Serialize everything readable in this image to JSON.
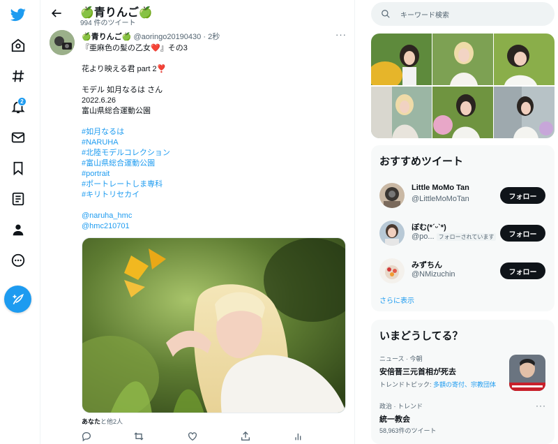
{
  "header": {
    "name": "🍏青りんご🍏",
    "tweet_count": "994 件のツイート"
  },
  "nav": {
    "notification_badge": "2"
  },
  "tweet": {
    "display_name": "🍏青りんご🍏",
    "handle": "@aoringo20190430",
    "sep": "·",
    "time": "2秒",
    "more": "···",
    "lines": [
      {
        "t": "『亜麻色の髪の乙女❤️』その3",
        "h": false
      },
      {
        "t": "",
        "h": false
      },
      {
        "t": "花より映える君 part 2❣️",
        "h": false
      },
      {
        "t": "",
        "h": false
      },
      {
        "t": "モデル 如月なるは さん",
        "h": false
      },
      {
        "t": "2022.6.26",
        "h": false
      },
      {
        "t": "富山県総合運動公園",
        "h": false
      },
      {
        "t": "",
        "h": false
      },
      {
        "t": "#如月なるは",
        "h": true
      },
      {
        "t": "#NARUHA",
        "h": true
      },
      {
        "t": "#北陸モデルコレクション",
        "h": true
      },
      {
        "t": "#富山県総合運動公園",
        "h": true
      },
      {
        "t": "#portrait",
        "h": true
      },
      {
        "t": "#ポートレートしま専科",
        "h": true
      },
      {
        "t": "#キリトリセカイ",
        "h": true
      },
      {
        "t": "",
        "h": false
      },
      {
        "t": "@naruha_hmc",
        "h": true
      },
      {
        "t": "@hmc210701",
        "h": true
      }
    ],
    "liked_by_user": "あなた",
    "liked_by_rest": "と他2人"
  },
  "search": {
    "placeholder": "キーワード検索"
  },
  "recommended": {
    "title": "おすすめツイート",
    "users": [
      {
        "name": "Little MoMo Tan",
        "handle": "@LittleMoMoTan",
        "button": "フォロー"
      },
      {
        "name": "ぼむ(*´ᵕ`*)",
        "handle": "@po...",
        "follows_you": "フォローされています",
        "button": "フォロー"
      },
      {
        "name": "みずちん",
        "handle": "@NMizuchin",
        "button": "フォロー"
      }
    ],
    "show_more": "さらに表示"
  },
  "trends": {
    "title": "いまどうしてる？",
    "items": [
      {
        "context": "ニュース · 今朝",
        "title": "安倍晋三元首相が死去",
        "topic_prefix": "トレンドトピック: ",
        "topic_links": "多額の寄付、宗教団体"
      },
      {
        "context": "政治 · トレンド",
        "title": "統一教会",
        "count": "58,963件のツイート",
        "more": "···"
      }
    ]
  },
  "colors": {
    "accent": "#1d9bf0",
    "text": "#0f1419",
    "muted": "#536471",
    "panel": "#f7f9f9"
  }
}
